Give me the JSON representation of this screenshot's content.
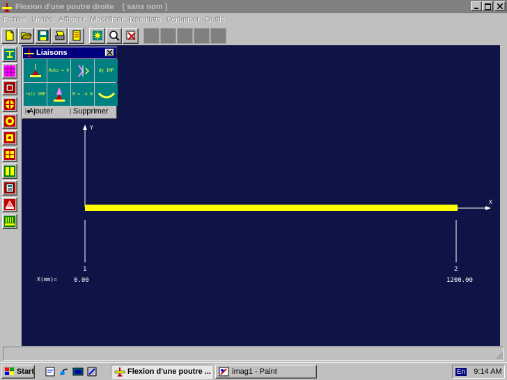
{
  "window": {
    "title": "Flexion d'une poutre droite    [ sans nom ]"
  },
  "menu": [
    {
      "label": "Fichier"
    },
    {
      "label": "Unités"
    },
    {
      "label": "Afficher"
    },
    {
      "label": "Modéliser"
    },
    {
      "label": "Résultats"
    },
    {
      "label": "Optimiser"
    },
    {
      "label": "Outils"
    }
  ],
  "toolbar": {
    "icons": [
      "new-file-icon",
      "open-folder-icon",
      "save-icon",
      "print-icon",
      "notes-icon",
      "calculate-icon",
      "zoom-icon",
      "reset-icon",
      "disabled-1",
      "disabled-2",
      "disabled-3",
      "disabled-4",
      "disabled-5"
    ]
  },
  "left_tools": {
    "icons": [
      "beam-section-icon",
      "grid-pattern-icon",
      "panel-icon",
      "target-icon",
      "ring-icon",
      "box-icon",
      "table-icon",
      "layout-icon",
      "calculator-icon",
      "support-icon",
      "loads-icon"
    ]
  },
  "liaisons": {
    "title": "Liaisons",
    "cells": [
      {
        "icon": "simple-support-icon",
        "text": ""
      },
      {
        "icon": "rotation-zero-icon",
        "text": "Rotz = 0"
      },
      {
        "icon": "hinge-icon",
        "text": ""
      },
      {
        "icon": "imposed-dy-icon",
        "text": "dy IMP"
      },
      {
        "icon": "imposed-rotz-icon",
        "text": "rotz IMP"
      },
      {
        "icon": "fixed-support-icon",
        "text": ""
      },
      {
        "icon": "moment-icon",
        "text": "M = -k θ"
      },
      {
        "icon": "spring-icon",
        "text": ""
      }
    ],
    "radio_add": "Ajouter",
    "radio_remove": "Supprimer",
    "selected": "Ajouter"
  },
  "canvas": {
    "axis_y": "Y",
    "axis_x": "X",
    "x_caption": "X(mm)=",
    "nodes": [
      {
        "id": "1",
        "x": "0.00"
      },
      {
        "id": "2",
        "x": "1200.00"
      }
    ],
    "beam_color": "#ffff00",
    "background": "#0f1446"
  },
  "taskbar": {
    "start": "Start",
    "tasks": [
      {
        "label": "Flexion d'une poutre ...",
        "active": true
      },
      {
        "label": "imag1 - Paint",
        "active": false
      }
    ],
    "lang": "En",
    "clock": "9:14 AM"
  }
}
